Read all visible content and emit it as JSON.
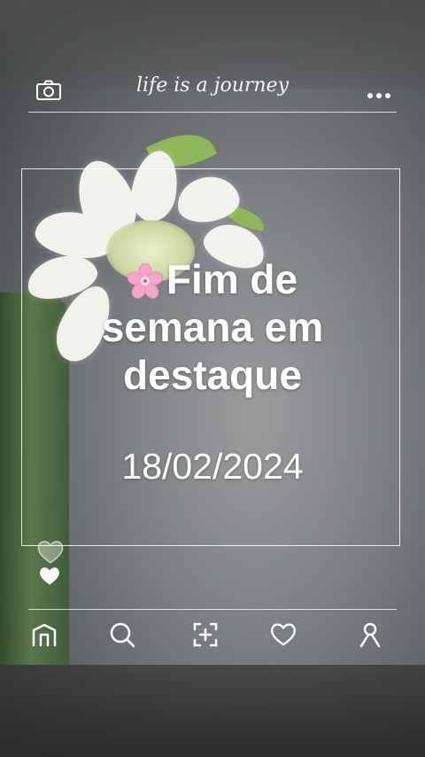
{
  "header": {
    "title": "life is a journey",
    "left_icon": "camera-icon",
    "right_icon": "more-icon"
  },
  "post": {
    "headline_line1": "Fim de",
    "headline_line2": "semana em",
    "headline_line3": "destaque",
    "date": "18/02/2024",
    "emoji_icon": "cherry-blossom-icon"
  },
  "side_icons": [
    "heart-outline-icon",
    "heart-filled-icon"
  ],
  "bottom_nav": {
    "items": [
      "home-icon",
      "search-icon",
      "add-post-icon",
      "likes-icon",
      "profile-icon"
    ]
  },
  "colors": {
    "text": "#ffffff",
    "sakura": "#f4a6c6",
    "leaf": "#8fb65a",
    "background": "#7f8284"
  }
}
